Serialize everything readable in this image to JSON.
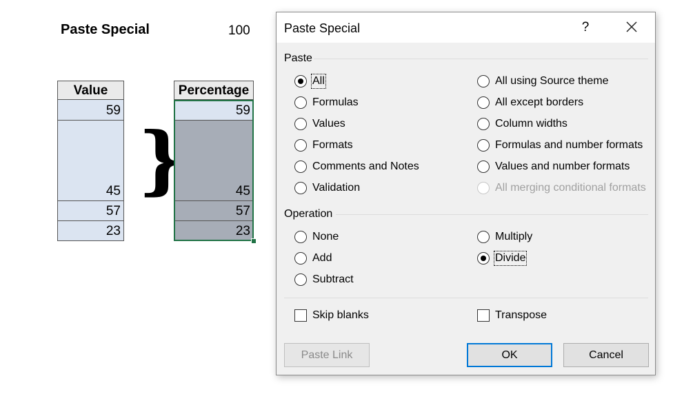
{
  "sheet": {
    "title": "Paste Special",
    "divisor": "100",
    "value_header": "Value",
    "percentage_header": "Percentage",
    "values": [
      "59",
      "45",
      "57",
      "23"
    ],
    "percentages": [
      "59",
      "45",
      "57",
      "23"
    ]
  },
  "dialog": {
    "title": "Paste Special",
    "help": "?",
    "paste_group": "Paste",
    "paste_left": [
      "All",
      "Formulas",
      "Values",
      "Formats",
      "Comments and Notes",
      "Validation"
    ],
    "paste_right": [
      "All using Source theme",
      "All except borders",
      "Column widths",
      "Formulas and number formats",
      "Values and number formats",
      "All merging conditional formats"
    ],
    "paste_selected": "All",
    "operation_group": "Operation",
    "operation_left": [
      "None",
      "Add",
      "Subtract"
    ],
    "operation_right": [
      "Multiply",
      "Divide"
    ],
    "operation_selected": "Divide",
    "skip_blanks": "Skip blanks",
    "transpose": "Transpose",
    "paste_link": "Paste Link",
    "ok": "OK",
    "cancel": "Cancel"
  },
  "colors": {
    "selection_border": "#217346",
    "value_fill": "#dbe4f1",
    "selected_fill": "#a7adb7",
    "default_button_border": "#0078d7"
  }
}
